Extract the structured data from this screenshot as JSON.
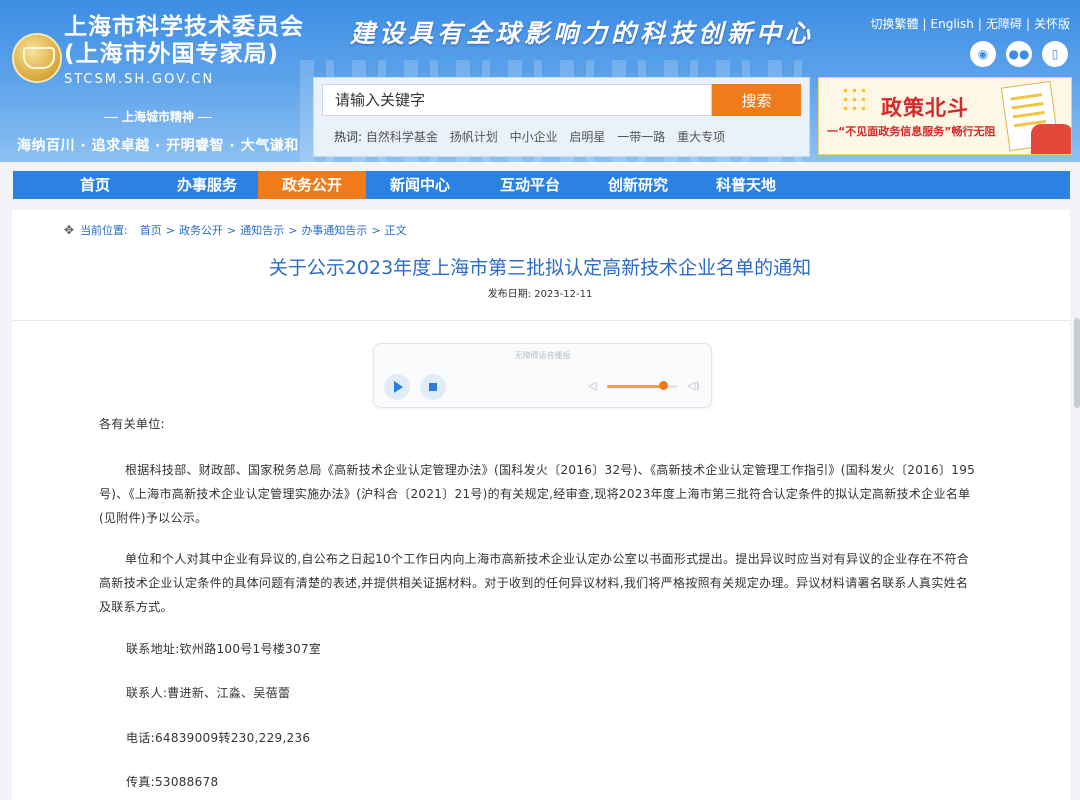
{
  "header": {
    "org_name_line1": "上海市科学技术委员会",
    "org_name_line2": "(上海市外国专家局)",
    "domain": "STCSM.SH.GOV.CN",
    "spirit_title": "上海城市精神",
    "spirit_text": "海纳百川 · 追求卓越 · 开明睿智 · 大气谦和",
    "slogan": "建设具有全球影响力的科技创新中心",
    "top_links": [
      "切换繁體",
      "English",
      "无障碍",
      "关怀版"
    ],
    "social_icons": [
      "weibo-icon",
      "wechat-icon",
      "mobile-icon"
    ]
  },
  "search": {
    "placeholder": "请输入关键字",
    "button_label": "搜索",
    "hot_label": "热词:",
    "hot_words": [
      "自然科学基金",
      "扬帆计划",
      "中小企业",
      "启明星",
      "一带一路",
      "重大专项"
    ]
  },
  "banner": {
    "title": "政策北斗",
    "subtitle": "一“不见面政务信息服务”畅行无阻"
  },
  "nav": {
    "items": [
      "首页",
      "办事服务",
      "政务公开",
      "新闻中心",
      "互动平台",
      "创新研究",
      "科普天地"
    ],
    "active_index": 2
  },
  "breadcrumb": {
    "label": "当前位置:",
    "crumbs": [
      "首页",
      "政务公开",
      "通知告示",
      "办事通知告示",
      "正文"
    ]
  },
  "article": {
    "title": "关于公示2023年度上海市第三批拟认定高新技术企业名单的通知",
    "pubdate_label": "发布日期:",
    "pubdate": "2023-12-11",
    "salutation": "各有关单位:",
    "para1": "根据科技部、财政部、国家税务总局《高新技术企业认定管理办法》(国科发火〔2016〕32号)、《高新技术企业认定管理工作指引》(国科发火〔2016〕195号)、《上海市高新技术企业认定管理实施办法》(沪科合〔2021〕21号)的有关规定,经审查,现将2023年度上海市第三批符合认定条件的拟认定高新技术企业名单(见附件)予以公示。",
    "para2": "单位和个人对其中企业有异议的,自公布之日起10个工作日内向上海市高新技术企业认定办公室以书面形式提出。提出异议时应当对有异议的企业存在不符合高新技术企业认定条件的具体问题有清楚的表述,并提供相关证据材料。对于收到的任何异议材料,我们将严格按照有关规定办理。异议材料请署名联系人真实姓名及联系方式。",
    "address": "联系地址:钦州路100号1号楼307室",
    "contacts": "联系人:曹进新、江淼、吴蓓蕾",
    "phone": "电话:64839009转230,229,236",
    "fax": "传真:53088678"
  },
  "player": {
    "label": "无障碍语音播报",
    "volume": 0.8
  }
}
